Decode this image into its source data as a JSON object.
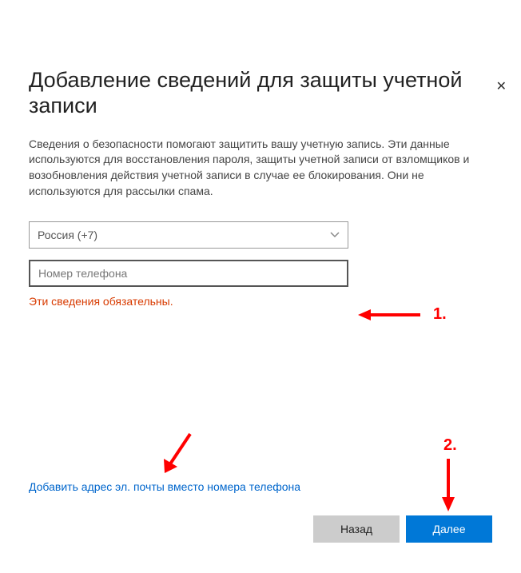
{
  "dialog": {
    "title": "Добавление сведений для защиты учетной записи",
    "body": "Сведения о безопасности помогают защитить вашу учетную запись. Эти данные используются для восстановления пароля, защиты учетной записи от взломщиков и возобновления действия учетной записи в случае ее блокирования. Они не используются для рассылки спама.",
    "country_selected": "Россия (+7)",
    "phone_placeholder": "Номер телефона",
    "error": "Эти сведения обязательны.",
    "email_link": "Добавить адрес эл. почты вместо номера телефона",
    "back_label": "Назад",
    "next_label": "Далее"
  },
  "annotations": {
    "label1": "1.",
    "label2": "2."
  }
}
